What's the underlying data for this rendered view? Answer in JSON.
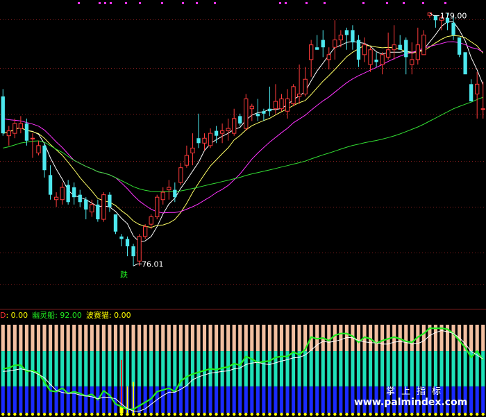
{
  "colors": {
    "background": "#000000",
    "up": "#ff3b3b",
    "down": "#4de8ee",
    "ma_short": "#ffffff",
    "ma_mid": "#ffff66",
    "ma_long": "#ff33ff",
    "ma_xlong": "#33dd33",
    "grid": "#8a1f1f",
    "dots": "#ff33ff",
    "bar_salmon": "#f2bfa0",
    "bar_teal": "#1ee0b8",
    "bar_blue": "#1a2aff",
    "bar_yellow": "#ffff00",
    "bar_red": "#ff2a2a",
    "ind_green": "#22ee22",
    "ind_white": "#ffffff"
  },
  "price_panel": {
    "high_label": "179.00",
    "low_label": "76.01",
    "signal_label": "跌"
  },
  "indicator_header": {
    "items": [
      {
        "name": "D",
        "value": ": 0.00",
        "name_color": "#ff3333",
        "value_color": "#ffff00"
      },
      {
        "name": "幽灵船",
        "value": ": 92.00",
        "name_color": "#22ee22",
        "value_color": "#22ee22"
      },
      {
        "name": "波赛猫",
        "value": ": 0.00",
        "name_color": "#ffff00",
        "value_color": "#ffff00"
      }
    ]
  },
  "watermark": {
    "cn": "掌上指标",
    "en": "www.palmindex.com"
  },
  "chart_data": {
    "type": "candlestick",
    "price_range": [
      60,
      182
    ],
    "candles": [
      [
        145,
        145,
        130,
        129,
        148
      ],
      [
        138,
        129,
        131,
        125,
        133
      ],
      [
        131,
        130,
        134,
        128,
        136
      ],
      [
        134,
        132,
        134,
        130,
        137
      ],
      [
        134,
        134,
        127,
        125,
        136
      ],
      [
        127,
        128,
        128,
        120,
        130
      ],
      [
        128,
        122,
        125,
        121,
        127
      ],
      [
        125,
        125,
        115,
        112,
        126
      ],
      [
        115,
        113,
        105,
        103,
        117
      ],
      [
        105,
        103,
        104,
        100,
        106
      ],
      [
        104,
        103,
        108,
        101,
        110
      ],
      [
        108,
        109,
        102,
        101,
        111
      ],
      [
        102,
        108,
        104,
        101,
        110
      ],
      [
        104,
        105,
        102,
        100,
        107
      ],
      [
        102,
        103,
        99,
        95,
        104
      ],
      [
        99,
        98,
        101,
        96,
        103
      ],
      [
        101,
        101,
        95,
        94,
        103
      ],
      [
        95,
        95,
        105,
        94,
        106
      ],
      [
        105,
        105,
        100,
        98,
        106
      ],
      [
        100,
        97,
        90,
        89,
        97
      ],
      [
        90,
        88,
        87,
        84,
        89
      ],
      [
        87,
        87,
        84,
        80,
        88
      ],
      [
        84,
        84,
        80,
        76,
        85
      ],
      [
        80,
        78,
        88,
        76.01,
        89
      ],
      [
        88,
        88,
        92,
        87,
        93
      ],
      [
        92,
        93,
        96,
        91,
        97
      ],
      [
        96,
        96,
        104,
        95,
        105
      ],
      [
        104,
        103,
        106,
        101,
        108
      ],
      [
        106,
        107,
        108,
        103,
        111
      ],
      [
        108,
        107,
        104,
        102,
        110
      ],
      [
        104,
        110,
        116,
        109,
        118
      ],
      [
        116,
        117,
        121,
        116,
        125
      ],
      [
        121,
        122,
        124,
        117,
        130
      ],
      [
        124,
        128,
        126,
        124,
        138
      ],
      [
        126,
        126,
        128,
        123,
        130
      ],
      [
        128,
        125,
        130,
        124,
        132
      ],
      [
        130,
        131,
        129,
        126,
        133
      ],
      [
        129,
        130,
        131,
        126,
        134
      ],
      [
        131,
        131,
        132,
        127,
        136
      ],
      [
        132,
        130,
        136,
        129,
        140
      ],
      [
        136,
        137,
        134,
        133,
        138
      ],
      [
        134,
        132,
        144,
        131,
        146
      ],
      [
        144,
        140,
        141,
        135,
        142
      ],
      [
        141,
        138,
        137,
        135,
        144
      ],
      [
        137,
        139,
        138,
        135,
        140
      ],
      [
        138,
        140,
        139,
        137,
        149
      ],
      [
        139,
        140,
        143,
        138,
        150
      ],
      [
        143,
        140,
        144,
        139,
        146
      ],
      [
        144,
        139,
        144,
        136,
        148
      ],
      [
        144,
        142,
        149,
        141,
        150
      ],
      [
        149,
        145,
        146,
        142,
        158
      ],
      [
        146,
        146,
        152,
        145,
        157
      ],
      [
        152,
        160,
        166,
        153,
        168
      ],
      [
        166,
        165,
        164,
        164,
        170
      ],
      [
        164,
        168,
        165,
        161,
        172
      ],
      [
        165,
        160,
        162,
        156,
        165
      ],
      [
        162,
        165,
        168,
        160,
        176
      ],
      [
        168,
        168,
        170,
        165,
        172
      ],
      [
        170,
        172,
        170,
        164,
        173
      ],
      [
        170,
        172,
        167,
        164,
        174
      ],
      [
        167,
        168,
        160,
        157,
        170
      ],
      [
        160,
        162,
        166,
        159,
        169
      ],
      [
        166,
        158,
        164,
        155,
        165
      ],
      [
        164,
        160,
        159,
        157,
        163
      ],
      [
        159,
        158,
        162,
        154,
        163
      ],
      [
        162,
        161,
        164,
        160,
        171
      ],
      [
        164,
        164,
        166,
        160,
        174
      ],
      [
        166,
        166,
        164,
        164,
        170
      ],
      [
        164,
        168,
        161,
        154,
        169
      ],
      [
        161,
        158,
        160,
        154,
        167
      ],
      [
        160,
        160,
        166,
        158,
        173
      ],
      [
        166,
        162,
        170,
        166,
        172
      ],
      [
        170,
        178,
        179,
        177,
        179
      ],
      [
        179,
        178,
        176,
        173,
        177
      ],
      [
        176,
        176,
        177,
        172,
        178
      ],
      [
        177,
        177,
        175,
        172,
        179
      ],
      [
        175,
        175,
        170,
        168,
        178
      ],
      [
        170,
        169,
        162,
        161,
        167
      ],
      [
        162,
        163,
        154,
        156,
        160
      ],
      [
        154,
        150,
        143,
        143,
        152
      ],
      [
        143,
        146,
        150,
        136,
        155
      ],
      [
        150,
        140,
        140,
        136,
        151
      ]
    ]
  }
}
